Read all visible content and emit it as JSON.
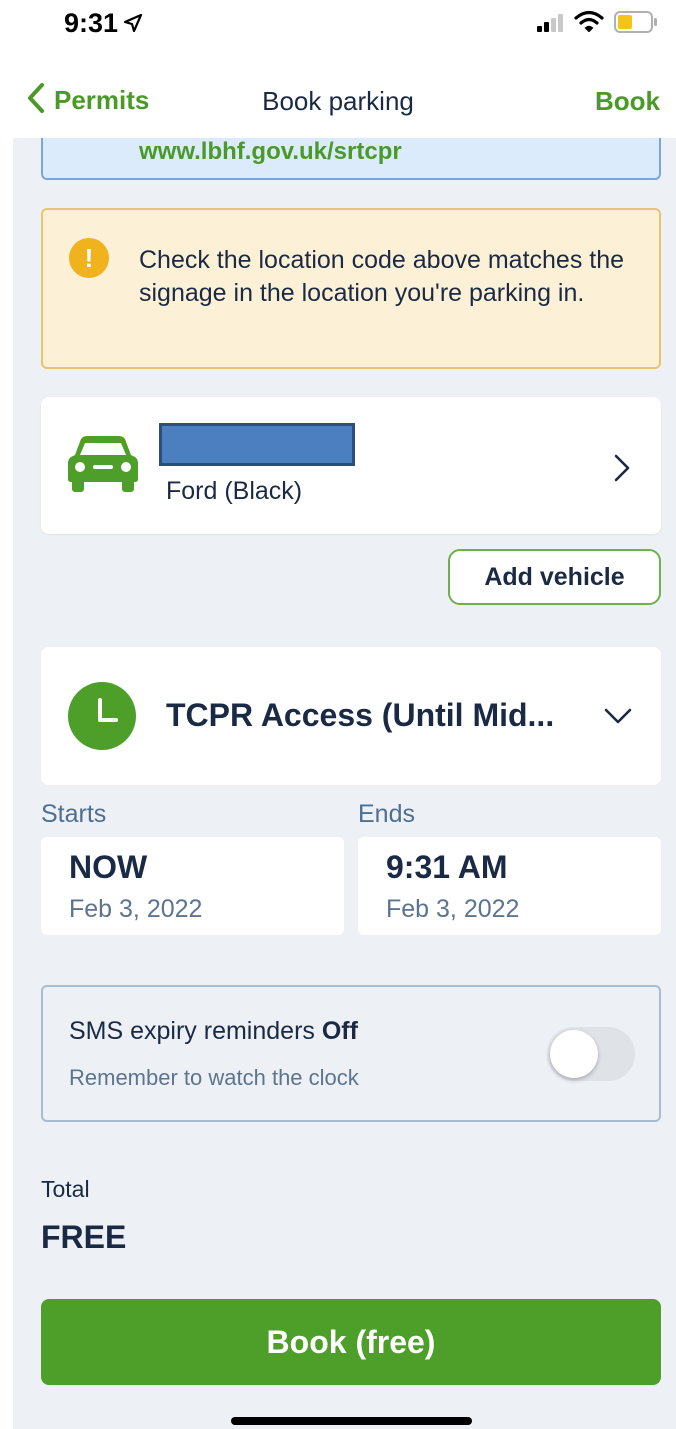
{
  "status_bar": {
    "time": "9:31",
    "icons": [
      "location-arrow-icon",
      "signal-icon",
      "wifi-icon",
      "battery-icon"
    ]
  },
  "nav": {
    "back_label": "Permits",
    "title": "Book parking",
    "action_label": "Book"
  },
  "info_box": {
    "link_text": "www.lbhf.gov.uk/srtcpr"
  },
  "warning": {
    "icon": "exclamation-icon",
    "text": "Check the location code above matches the signage in the location you're parking in."
  },
  "vehicle": {
    "icon": "car-icon",
    "description": "Ford (Black)"
  },
  "add_vehicle": {
    "label": "Add vehicle"
  },
  "permit": {
    "icon": "clock-icon",
    "label": "TCPR Access (Until Mid..."
  },
  "starts": {
    "label": "Starts",
    "time": "NOW",
    "date": "Feb 3, 2022"
  },
  "ends": {
    "label": "Ends",
    "time": "9:31 AM",
    "date": "Feb 3, 2022"
  },
  "sms": {
    "title_prefix": "SMS expiry reminders ",
    "title_state": "Off",
    "subtitle": "Remember to watch the clock"
  },
  "total": {
    "label": "Total",
    "value": "FREE"
  },
  "book_button": {
    "label": "Book (free)"
  },
  "colors": {
    "accent": "#4d9f2a",
    "text": "#1b2a44",
    "background": "#edf1f6",
    "warning": "#f0b31e"
  }
}
